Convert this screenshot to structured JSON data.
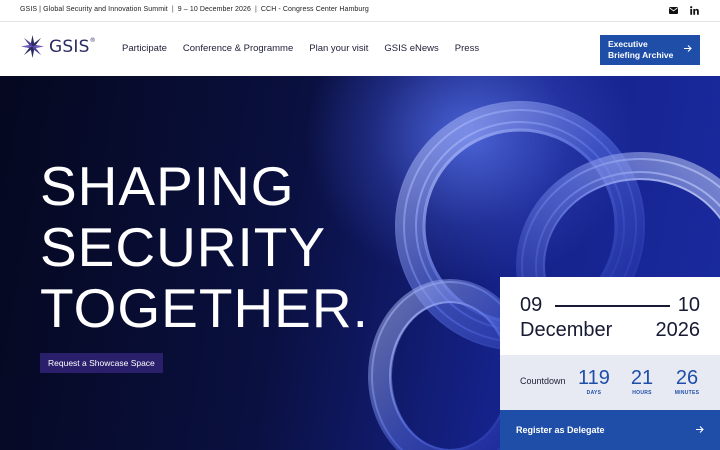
{
  "topbar": {
    "event_name": "GSIS | Global Security and Innovation Summit",
    "dates": "9 – 10 December 2026",
    "venue": "CCH - Congress Center Hamburg",
    "icons": [
      "mail-icon",
      "linkedin-icon"
    ]
  },
  "header": {
    "logo_text": "GSIS",
    "logo_mark": "®",
    "nav": [
      "Participate",
      "Conference & Programme",
      "Plan your visit",
      "GSIS eNews",
      "Press"
    ],
    "cta_label": "Executive Briefing Archive"
  },
  "hero": {
    "headline_lines": [
      "SHAPING",
      "SECURITY",
      "TOGETHER."
    ],
    "cta_label": "Request a Showcase Space"
  },
  "event_card": {
    "day_start": "09",
    "day_end": "10",
    "month": "December",
    "year": "2026",
    "countdown_label": "Countdown",
    "countdown": [
      {
        "value": "119",
        "unit": "DAYS"
      },
      {
        "value": "21",
        "unit": "HOURS"
      },
      {
        "value": "26",
        "unit": "MINUTES"
      }
    ],
    "register_label": "Register as Delegate"
  },
  "colors": {
    "accent": "#1f4ea8",
    "hero_dark": "#0a1040",
    "showcase": "#2a1f6a",
    "countdown_bg": "#e8eaf3"
  }
}
